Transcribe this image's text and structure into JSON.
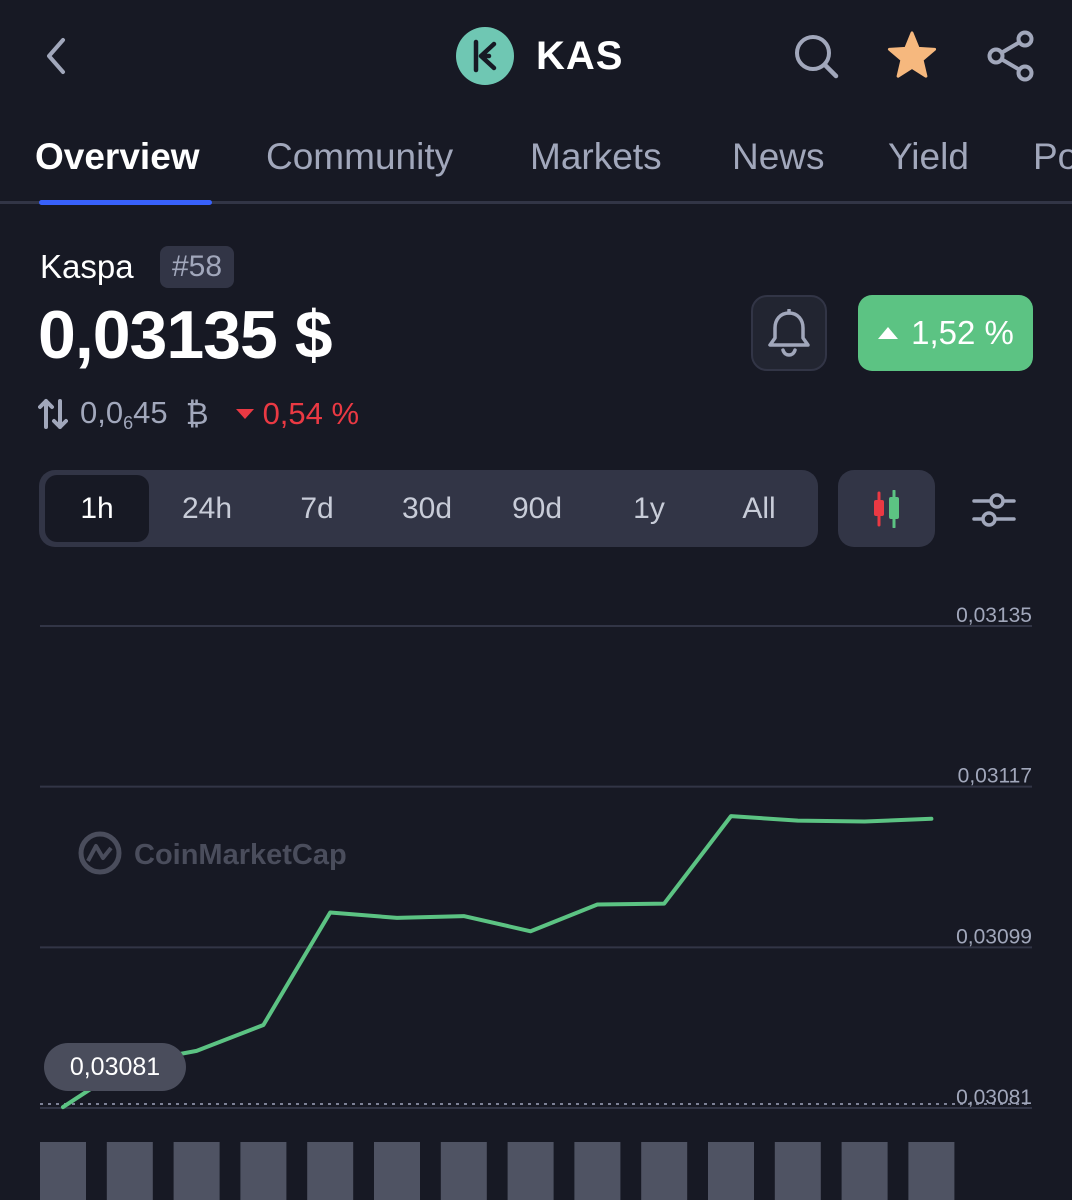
{
  "header": {
    "symbol": "KAS",
    "logo_icon": "kaspa-logo-icon",
    "logo_color": "#6fc7b3",
    "back_icon": "chevron-left-icon",
    "search_icon": "search-icon",
    "watchlist_icon": "star-icon",
    "watchlist_color": "#f6b87e",
    "share_icon": "share-icon"
  },
  "tabs": [
    {
      "label": "Overview",
      "active": true
    },
    {
      "label": "Community",
      "active": false
    },
    {
      "label": "Markets",
      "active": false
    },
    {
      "label": "News",
      "active": false
    },
    {
      "label": "Yield",
      "active": false
    },
    {
      "label": "Po",
      "active": false
    }
  ],
  "coin": {
    "name": "Kaspa",
    "rank": "#58",
    "price": "0,03135 $",
    "change_24h": "1,52 %",
    "change_direction": "up",
    "btc_price_main": "0,0",
    "btc_price_sub": "6",
    "btc_price_tail": "45",
    "btc_symbol": "₿",
    "btc_change": "0,54 %",
    "btc_change_direction": "down"
  },
  "colors": {
    "background": "#171924",
    "accent": "#3861fb",
    "positive": "#5cc383",
    "negative": "#ea3943",
    "line": "#5cc383"
  },
  "range_selector": {
    "options": [
      "1h",
      "24h",
      "7d",
      "30d",
      "90d",
      "1y",
      "All"
    ],
    "selected": "1h"
  },
  "chart_data": {
    "type": "line",
    "watermark": "CoinMarketCap",
    "y_tick_labels": [
      "0,03135",
      "0,03117",
      "0,03099",
      "0,03081"
    ],
    "y_ticks": [
      0.03135,
      0.03117,
      0.03099,
      0.03081
    ],
    "ylim": [
      0.03081,
      0.03135
    ],
    "x": [
      0,
      1,
      2,
      3,
      4,
      5,
      6,
      7,
      8,
      9,
      10,
      11,
      12,
      13
    ],
    "values": [
      0.030811,
      0.03086,
      0.030874,
      0.030903,
      0.031029,
      0.031023,
      0.031025,
      0.031008,
      0.031038,
      0.031039,
      0.031137,
      0.031132,
      0.031131,
      0.031134
    ],
    "low_label": "0,03081",
    "volume": [
      1,
      1,
      1,
      1,
      1,
      1,
      1,
      1,
      1,
      1,
      1,
      1,
      1,
      1
    ],
    "grid": true
  }
}
